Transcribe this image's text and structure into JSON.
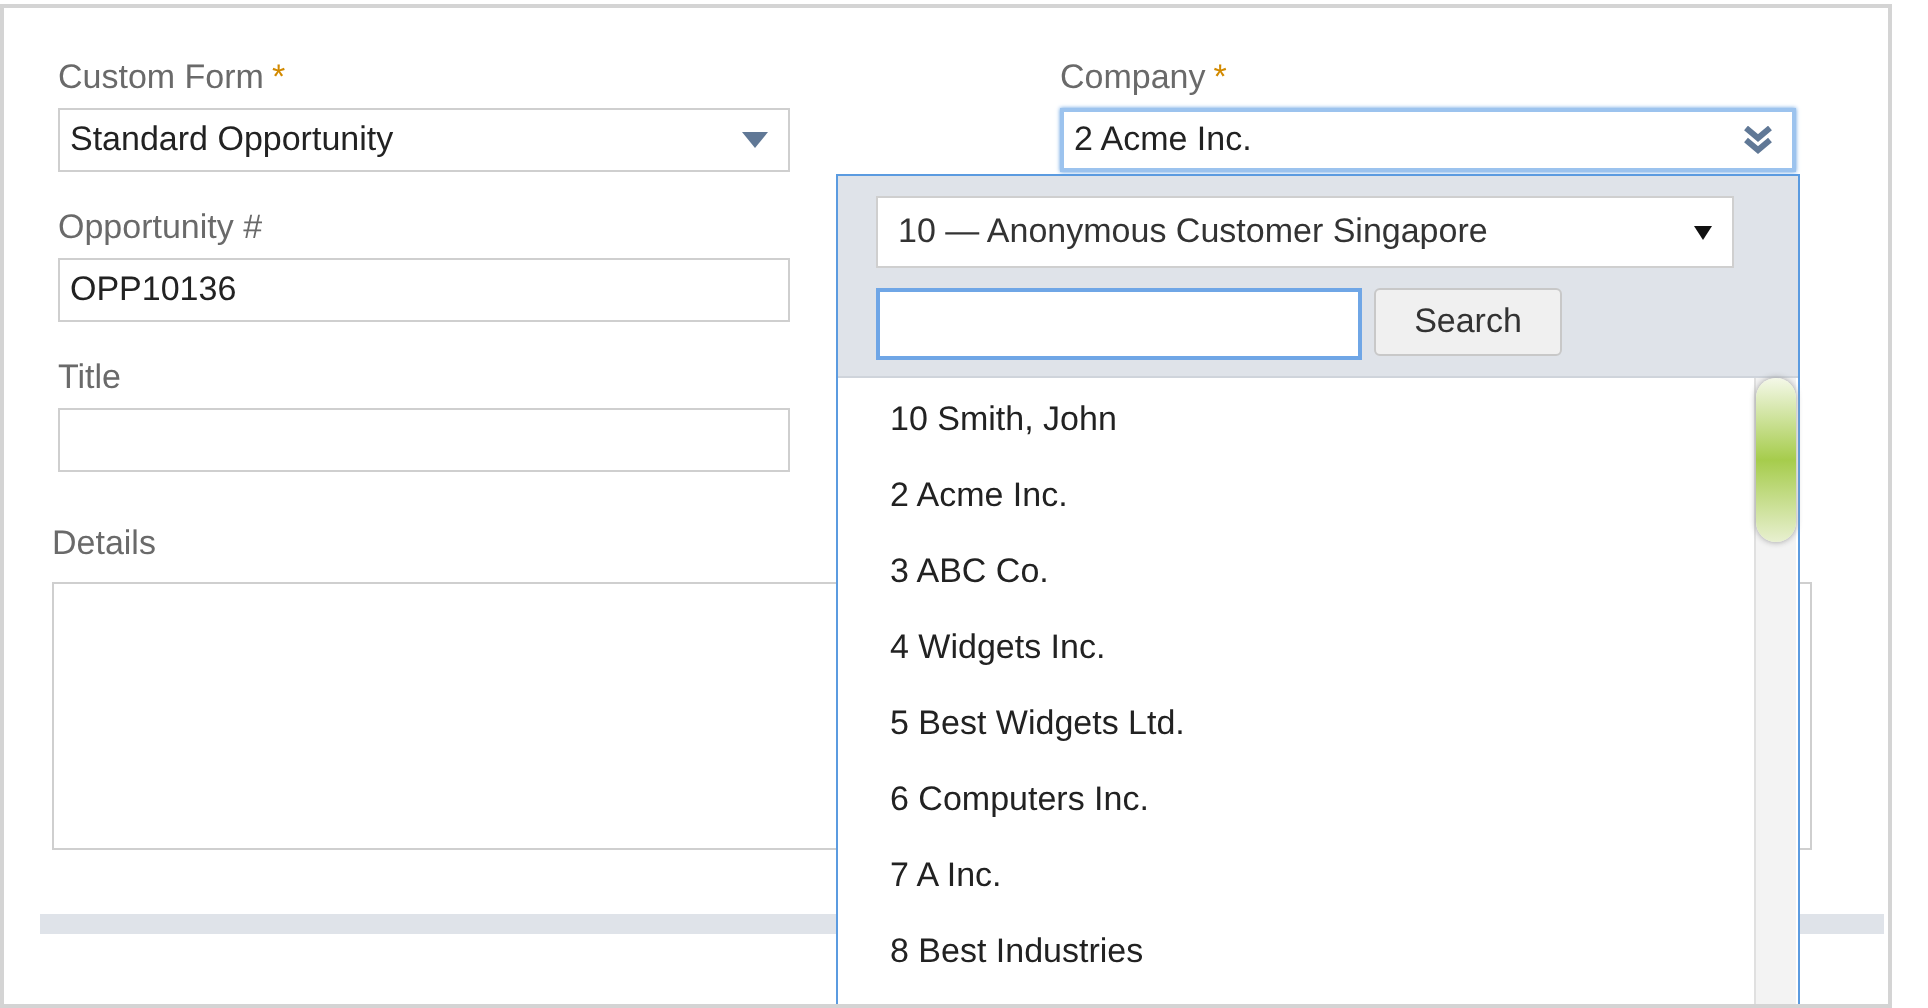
{
  "left_fields": [
    {
      "label": "Custom Form",
      "required_mark": "*",
      "kind": "select",
      "value": "Standard Opportunity"
    },
    {
      "label": "Opportunity #",
      "kind": "text",
      "value": "OPP10136"
    },
    {
      "label": "Title",
      "kind": "text"
    }
  ],
  "company": {
    "label": "Company",
    "required_mark": "*",
    "value": "2 Acme Inc.",
    "focused": true
  },
  "details": {
    "label": "Details"
  },
  "popup": {
    "filter": "10 — Anonymous Customer Singapore",
    "search_button": "Search",
    "items": [
      {
        "label": "10 Smith, John"
      },
      {
        "label": "2 Acme Inc."
      },
      {
        "label": "3 ABC Co."
      },
      {
        "label": "4 Widgets Inc."
      },
      {
        "label": "5 Best Widgets Ltd."
      },
      {
        "label": "6 Computers Inc."
      },
      {
        "label": "7 A Inc."
      },
      {
        "label": "8 Best Industries"
      }
    ]
  }
}
